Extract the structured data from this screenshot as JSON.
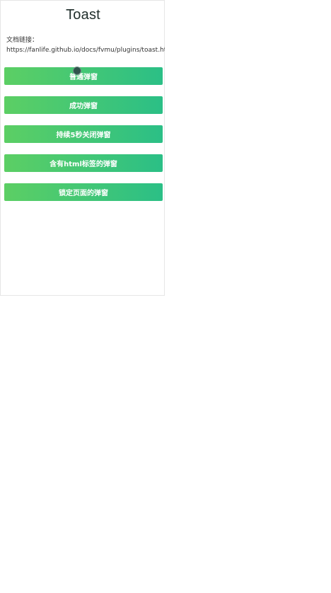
{
  "page": {
    "title": "Toast",
    "doc_label": "文档链接：",
    "doc_link": "https://fanlife.github.io/docs/fvmu/plugins/toast.html"
  },
  "buttons": [
    {
      "label": "普通弹窗"
    },
    {
      "label": "成功弹窗"
    },
    {
      "label": "持续5秒关闭弹窗"
    },
    {
      "label": "含有html标签的弹窗"
    },
    {
      "label": "锁定页面的弹窗"
    }
  ],
  "colors": {
    "button_gradient_start": "#5ccf64",
    "button_gradient_end": "#2bbf86",
    "button_text": "#ffffff",
    "title_text": "#1f2d2a"
  },
  "icons": {
    "pointer": "touch-pointer-icon"
  }
}
